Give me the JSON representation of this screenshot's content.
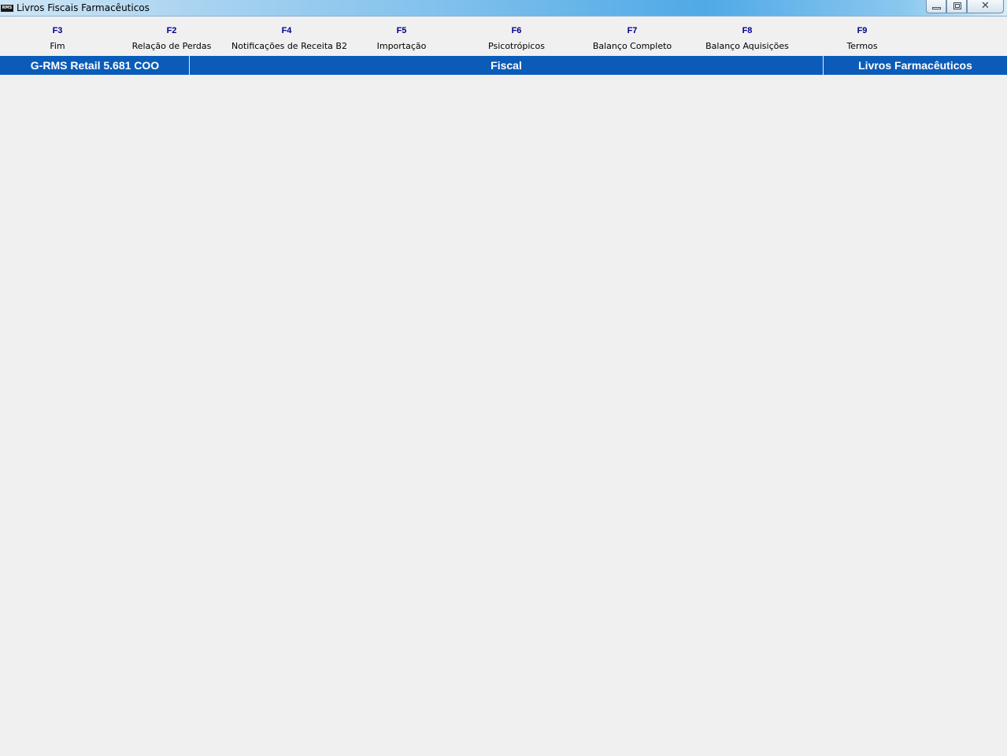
{
  "window": {
    "app_logo_text": "RMS",
    "title": "Livros Fiscais Farmacêuticos",
    "controls": {
      "minimize_icon": "minimize-icon",
      "maximize_icon": "restore-icon",
      "close_icon": "close-icon",
      "close_glyph": "✕"
    }
  },
  "function_keys": [
    {
      "key": "F3",
      "label": "Fim"
    },
    {
      "key": "F2",
      "label": "Relação de Perdas"
    },
    {
      "key": "F4",
      "label": "Notificações de Receita B2"
    },
    {
      "key": "F5",
      "label": "Importação"
    },
    {
      "key": "F6",
      "label": "Psicotrópicos"
    },
    {
      "key": "F7",
      "label": "Balanço Completo"
    },
    {
      "key": "F8",
      "label": "Balanço Aquisições"
    },
    {
      "key": "F9",
      "label": "Termos"
    }
  ],
  "status_bar": {
    "system": "G-RMS Retail 5.681 COO",
    "module": "Fiscal",
    "screen": "Livros Farmacêuticos"
  },
  "colors": {
    "status_bar_bg": "#0a5cb8",
    "fkey_code": "#00008b",
    "workspace_bg": "#f0f0f0"
  }
}
